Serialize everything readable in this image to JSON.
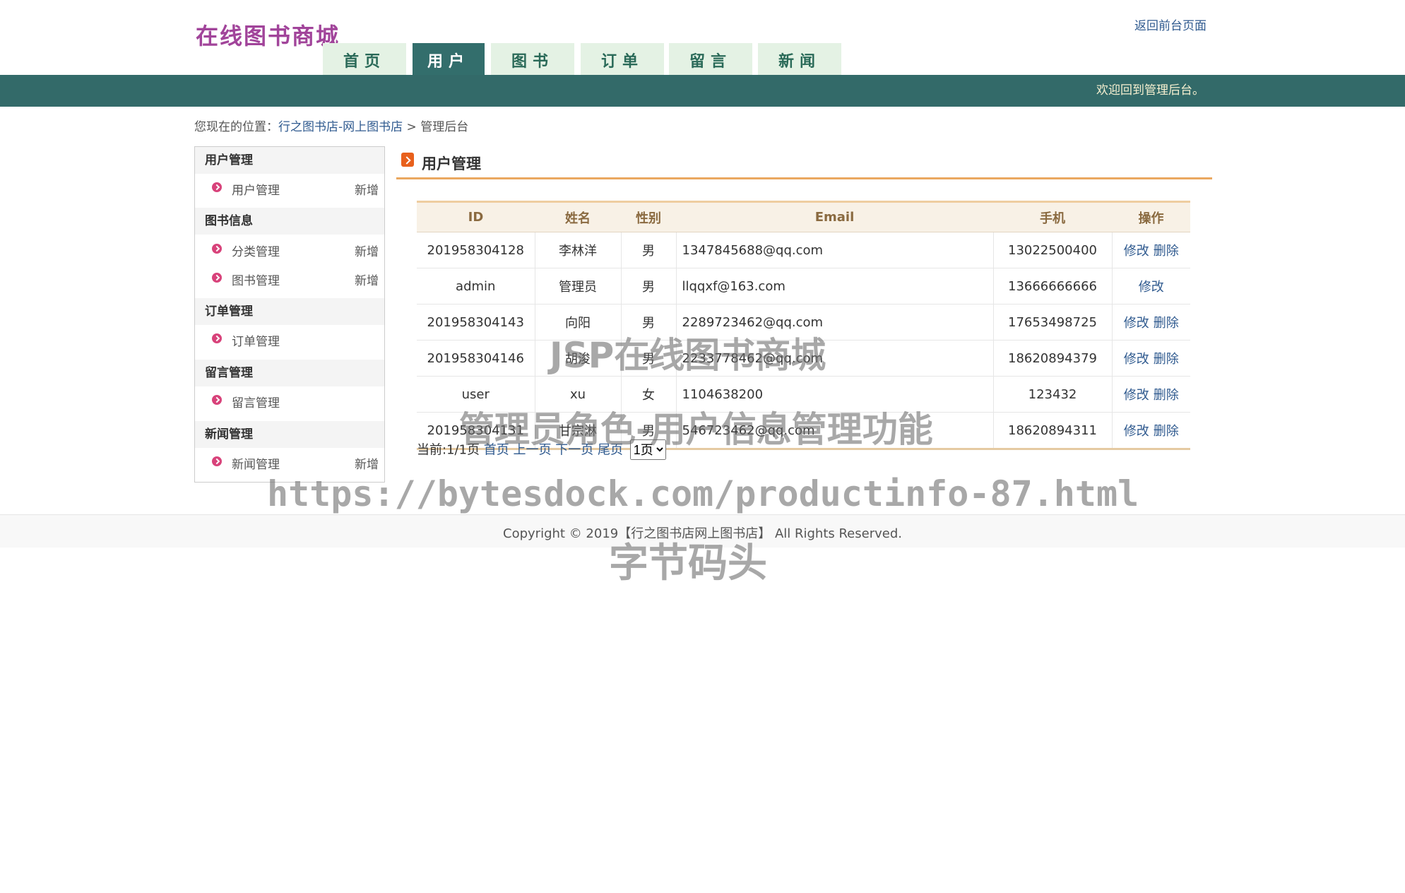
{
  "header": {
    "logo": "在线图书商城",
    "back_link": "返回前台页面",
    "tabs": [
      {
        "label": "首页",
        "active": false
      },
      {
        "label": "用户",
        "active": true
      },
      {
        "label": "图书",
        "active": false
      },
      {
        "label": "订单",
        "active": false
      },
      {
        "label": "留言",
        "active": false
      },
      {
        "label": "新闻",
        "active": false
      }
    ],
    "banner_text": "欢迎回到管理后台。"
  },
  "breadcrumb": {
    "prefix": "您现在的位置：",
    "link": "行之图书店-网上图书店",
    "separator": " > ",
    "current": "管理后台"
  },
  "sidebar": {
    "groups": [
      {
        "title": "用户管理",
        "items": [
          {
            "label": "用户管理",
            "add": "新增"
          }
        ]
      },
      {
        "title": "图书信息",
        "items": [
          {
            "label": "分类管理",
            "add": "新增"
          },
          {
            "label": "图书管理",
            "add": "新增"
          }
        ]
      },
      {
        "title": "订单管理",
        "items": [
          {
            "label": "订单管理",
            "add": ""
          }
        ]
      },
      {
        "title": "留言管理",
        "items": [
          {
            "label": "留言管理",
            "add": ""
          }
        ]
      },
      {
        "title": "新闻管理",
        "items": [
          {
            "label": "新闻管理",
            "add": "新增"
          }
        ]
      }
    ]
  },
  "main": {
    "title": "用户管理",
    "table": {
      "headers": [
        "ID",
        "姓名",
        "性别",
        "Email",
        "手机",
        "操作"
      ],
      "rows": [
        {
          "id": "201958304128",
          "name": "李林洋",
          "gender": "男",
          "email": "1347845688@qq.com",
          "phone": "13022500400",
          "edit": "修改",
          "del": "删除"
        },
        {
          "id": "admin",
          "name": "管理员",
          "gender": "男",
          "email": "llqqxf@163.com",
          "phone": "13666666666",
          "edit": "修改",
          "del": ""
        },
        {
          "id": "201958304143",
          "name": "向阳",
          "gender": "男",
          "email": "2289723462@qq.com",
          "phone": "17653498725",
          "edit": "修改",
          "del": "删除"
        },
        {
          "id": "201958304146",
          "name": "胡浚",
          "gender": "男",
          "email": "2233778462@qq.com",
          "phone": "18620894379",
          "edit": "修改",
          "del": "删除"
        },
        {
          "id": "user",
          "name": "xu",
          "gender": "女",
          "email": "1104638200",
          "phone": "123432",
          "edit": "修改",
          "del": "删除"
        },
        {
          "id": "201958304131",
          "name": "甘宗淋",
          "gender": "男",
          "email": "546723462@qq.com",
          "phone": "18620894311",
          "edit": "修改",
          "del": "删除"
        }
      ]
    },
    "pager": {
      "current": "当前:1/1页",
      "first": "首页",
      "prev": "上一页",
      "next": "下一页",
      "last": "尾页",
      "select_value": "1页"
    }
  },
  "footer": {
    "text": "Copyright © 2019【行之图书店网上图书店】 All Rights Reserved."
  },
  "watermark": {
    "line1": "JSP在线图书商城",
    "line2": "管理员角色-用户信息管理功能",
    "line3": "https://bytesdock.com/productinfo-87.html",
    "line4": "字节码头"
  }
}
